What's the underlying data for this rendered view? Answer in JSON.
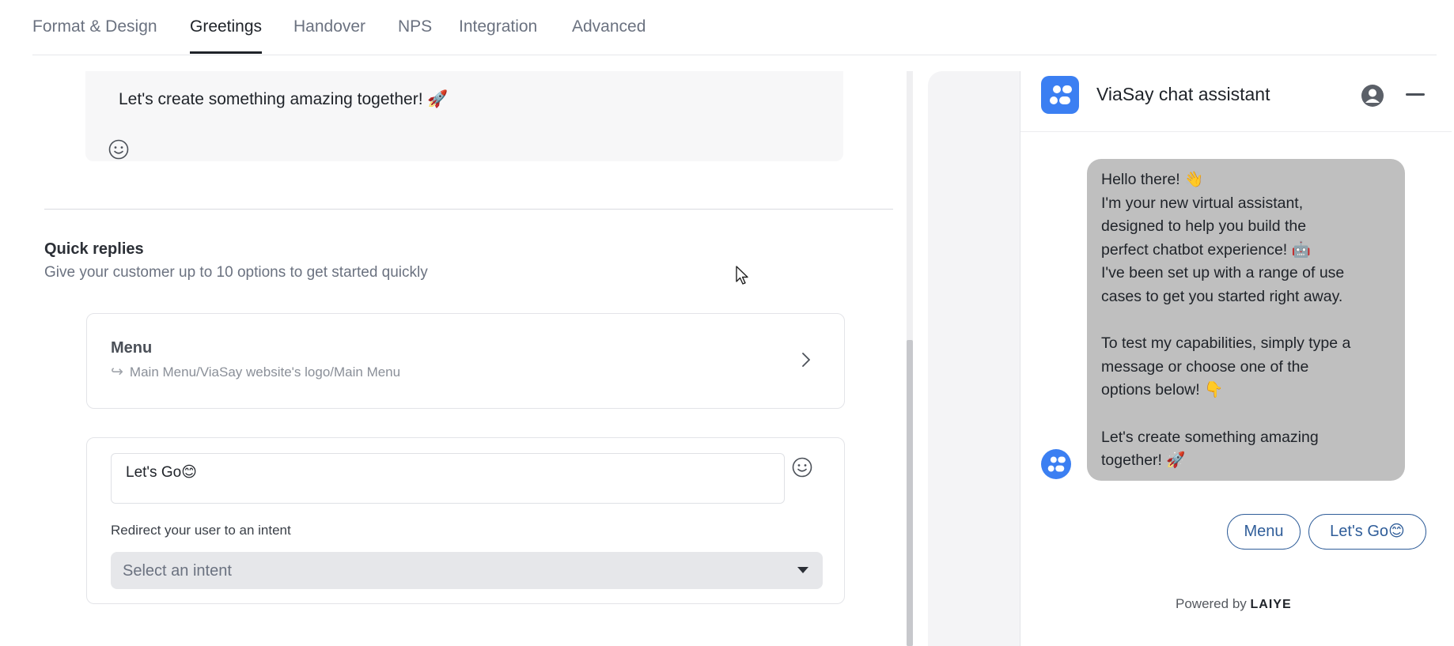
{
  "tabs": [
    {
      "label": "Format & Design",
      "active": false
    },
    {
      "label": "Greetings",
      "active": true
    },
    {
      "label": "Handover",
      "active": false
    },
    {
      "label": "NPS",
      "active": false
    },
    {
      "label": "Integration",
      "active": false
    },
    {
      "label": "Advanced",
      "active": false
    }
  ],
  "greeting": {
    "text": "Let's create something amazing together! 🚀"
  },
  "quick_replies": {
    "title": "Quick replies",
    "subtitle": "Give your customer up to 10 options to get started quickly",
    "menu_item": {
      "title": "Menu",
      "path": "Main Menu/ViaSay website's logo/Main Menu"
    },
    "reply_item": {
      "value": "Let's Go😊",
      "redirect_label": "Redirect your user to an intent",
      "select_placeholder": "Select an intent"
    }
  },
  "preview": {
    "title": "ViaSay chat assistant",
    "message_lines": [
      "Hello there! 👋",
      "I'm your new virtual assistant,",
      "designed to help you build the",
      "perfect chatbot experience! 🤖",
      "I've been set up with a range of use",
      "cases to get you started right away.",
      "",
      "To test my capabilities, simply type a",
      "message or choose one of the",
      "options below! 👇",
      "",
      "Let's create something amazing",
      "together! 🚀"
    ],
    "quick_reply_buttons": [
      "Menu",
      "Let's Go😊"
    ],
    "powered_by": "Powered by",
    "brand": "LAIYE"
  },
  "colors": {
    "accent": "#3b7ff2",
    "bubble": "#bfbfbf",
    "button_border": "#2f5d99"
  },
  "icons": [
    "smile-icon",
    "chevron-right-icon",
    "reply-arrow-icon",
    "caret-down-icon",
    "bot-logo-icon",
    "user-icon",
    "minimize-icon",
    "mouse-cursor-icon"
  ]
}
